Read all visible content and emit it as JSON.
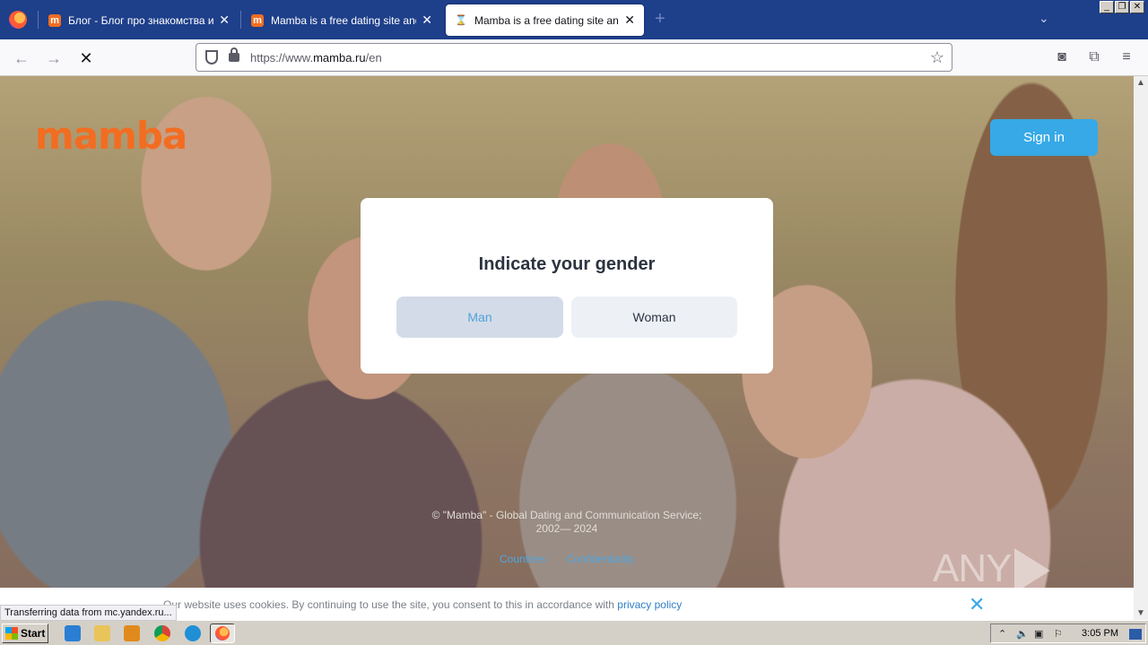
{
  "browser": {
    "tabs": [
      {
        "title": "Блог - Блог про знакомства и отношения",
        "favicon_text": "m",
        "favicon_color": "#f26d21",
        "active": false
      },
      {
        "title": "Mamba is a free dating site and a chat",
        "favicon_text": "m",
        "favicon_color": "#f26d21",
        "active": false
      },
      {
        "title": "Mamba is a free dating site and a chat",
        "favicon_text": "⌛",
        "favicon_color": "#ffffff",
        "active": true
      }
    ],
    "new_tab_icon": "+",
    "url_prefix": "https://www.",
    "url_domain": "mamba.ru",
    "url_path": "/en",
    "status_text": "Transferring data from mc.yandex.ru..."
  },
  "page": {
    "logo": "mamba",
    "sign_in": "Sign in",
    "modal": {
      "title": "Indicate your gender",
      "man": "Man",
      "woman": "Woman"
    },
    "footer": {
      "copyright_line1": "© \"Mamba\" - Global Dating and Communication Service;",
      "copyright_line2": "2002— 2024",
      "links": [
        "Countries",
        "Confidentiality"
      ]
    },
    "cookie": {
      "text": "Our website uses cookies. By continuing to use the site, you consent to this in accordance with ",
      "link": "privacy policy"
    },
    "watermark": "ANY  RUN"
  },
  "taskbar": {
    "start": "Start",
    "clock": "3:05 PM"
  },
  "colors": {
    "brand_orange": "#f26d21",
    "accent_blue": "#36a9e6",
    "tab_strip": "#1e3f8a"
  }
}
